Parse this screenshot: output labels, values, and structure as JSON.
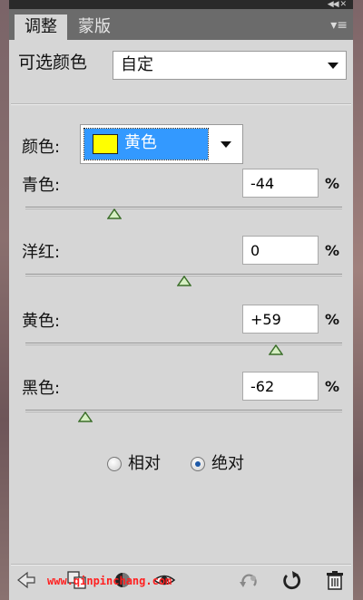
{
  "tabs": [
    {
      "label": "调整",
      "active": true
    },
    {
      "label": "蒙版",
      "active": false
    }
  ],
  "preset": {
    "label": "可选颜色",
    "value": "自定"
  },
  "colors": {
    "label": "颜色:",
    "value": "黄色",
    "swatch": "#ffff00",
    "highlight": "#3399ff"
  },
  "sliders": [
    {
      "label": "青色:",
      "value": "-44",
      "unit": "%",
      "position": 0.28
    },
    {
      "label": "洋红:",
      "value": "0",
      "unit": "%",
      "position": 0.5
    },
    {
      "label": "黄色:",
      "value": "+59",
      "unit": "%",
      "position": 0.79
    },
    {
      "label": "黑色:",
      "value": "-62",
      "unit": "%",
      "position": 0.19
    }
  ],
  "method": {
    "options": [
      {
        "label": "相对",
        "selected": false
      },
      {
        "label": "绝对",
        "selected": true
      }
    ]
  },
  "watermark": "www.qinpinchang.com",
  "icons": [
    "back-arrow-icon",
    "clip-layer-icon",
    "visibility-circle-icon",
    "eye-icon",
    "previous-state-icon",
    "reset-icon",
    "trash-icon"
  ]
}
